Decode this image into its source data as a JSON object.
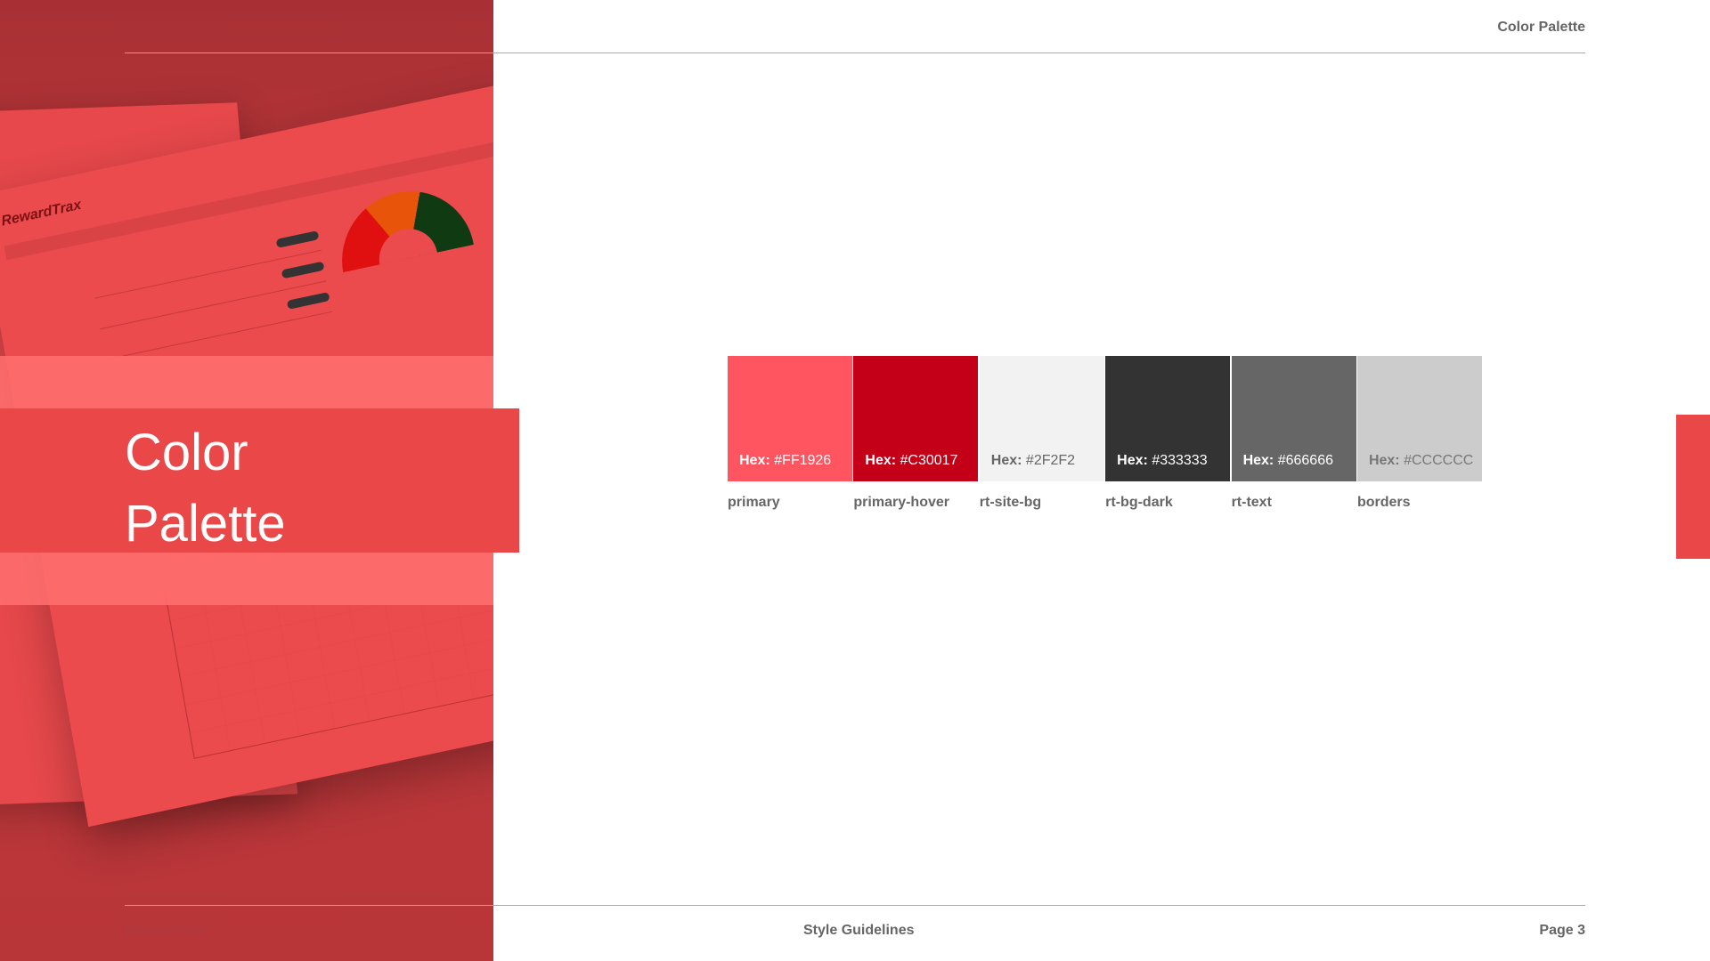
{
  "header": {
    "title": "Color Palette"
  },
  "hero": {
    "title_line1": "Color",
    "title_line2": "Palette",
    "mockup_logo": "RewardTrax"
  },
  "swatches": [
    {
      "name": "primary",
      "hex_prefix": "Hex:",
      "hex": "#FF1926",
      "color": "#FF5560",
      "label_color": "#ffffff"
    },
    {
      "name": "primary-hover",
      "hex_prefix": "Hex:",
      "hex": "#C30017",
      "color": "#C30017",
      "label_color": "#ffffff"
    },
    {
      "name": "rt-site-bg",
      "hex_prefix": "Hex:",
      "hex": "#2F2F2",
      "color": "#F2F2F2",
      "label_color": "#666666"
    },
    {
      "name": "rt-bg-dark",
      "hex_prefix": "Hex:",
      "hex": "#333333",
      "color": "#333333",
      "label_color": "#ffffff"
    },
    {
      "name": "rt-text",
      "hex_prefix": "Hex:",
      "hex": "#666666",
      "color": "#666666",
      "label_color": "#ffffff"
    },
    {
      "name": "borders",
      "hex_prefix": "Hex:",
      "hex": "#CCCCCC",
      "color": "#CCCCCC",
      "label_color": "#777777"
    }
  ],
  "footer": {
    "brand": "RewardTrax",
    "center": "Style Guidelines",
    "page": "Page 3"
  },
  "colors": {
    "accent": "#E94748",
    "text": "#666666",
    "rule": "#AAAAAA"
  }
}
